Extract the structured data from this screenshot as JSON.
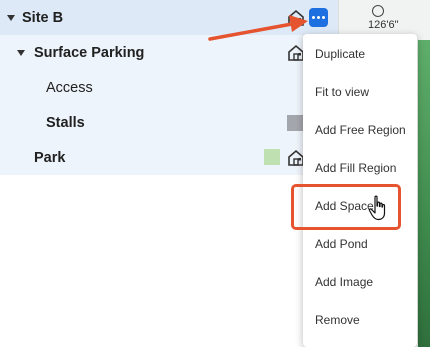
{
  "tree": {
    "items": [
      {
        "label": "Site B"
      },
      {
        "label": "Surface Parking"
      },
      {
        "label": "Access"
      },
      {
        "label": "Stalls"
      },
      {
        "label": "Park"
      }
    ]
  },
  "map": {
    "scale_label": "126'6\""
  },
  "menu": {
    "items": [
      {
        "label": "Duplicate"
      },
      {
        "label": "Fit to view"
      },
      {
        "label": "Add Free Region"
      },
      {
        "label": "Add Fill Region"
      },
      {
        "label": "Add Space"
      },
      {
        "label": "Add Pond"
      },
      {
        "label": "Add Image"
      },
      {
        "label": "Remove"
      }
    ]
  },
  "colors": {
    "accent": "#1e6fe0",
    "annotation": "#e5532f",
    "stalls_swatch": "#a4a6ad",
    "park_swatch": "#bfe0b1"
  },
  "icons": [
    "home-icon",
    "more-icon",
    "caret-down-icon",
    "hand-cursor-icon",
    "scale-icon"
  ]
}
